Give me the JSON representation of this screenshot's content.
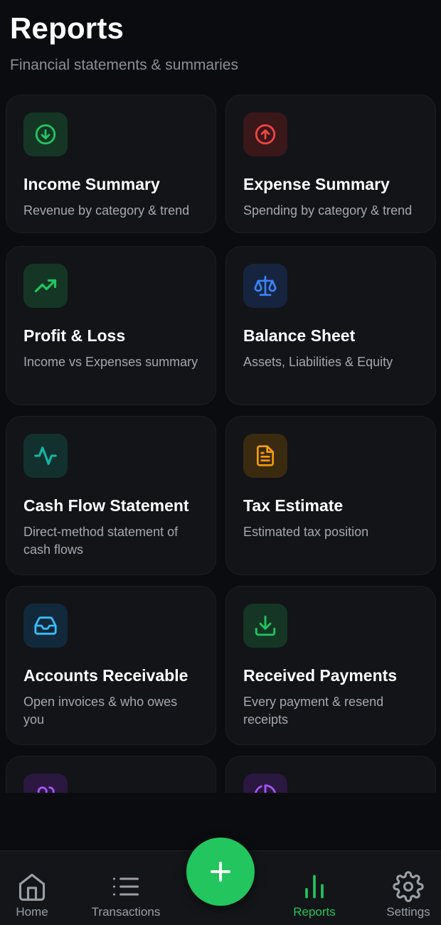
{
  "header": {
    "title": "Reports",
    "subtitle": "Financial statements & summaries"
  },
  "cards": [
    {
      "title": "Income Summary",
      "description": "Revenue by category & trend",
      "icon": "arrow-down-circle-icon",
      "color": "#22c55e"
    },
    {
      "title": "Expense Summary",
      "description": "Spending by category & trend",
      "icon": "arrow-up-circle-icon",
      "color": "#ef4444"
    },
    {
      "title": "Profit & Loss",
      "description": "Income vs Expenses summary",
      "icon": "trending-up-icon",
      "color": "#22c55e"
    },
    {
      "title": "Balance Sheet",
      "description": "Assets, Liabilities & Equity",
      "icon": "scale-icon",
      "color": "#3b82f6"
    },
    {
      "title": "Cash Flow Statement",
      "description": "Direct-method statement of cash flows",
      "icon": "activity-icon",
      "color": "#14b8a6"
    },
    {
      "title": "Tax Estimate",
      "description": "Estimated tax position",
      "icon": "document-icon",
      "color": "#f59e0b"
    },
    {
      "title": "Accounts Receivable",
      "description": "Open invoices & who owes you",
      "icon": "inbox-icon",
      "color": "#38bdf8"
    },
    {
      "title": "Received Payments",
      "description": "Every payment & resend receipts",
      "icon": "download-icon",
      "color": "#22c55e"
    },
    {
      "title": "",
      "description": "",
      "icon": "users-icon",
      "color": "#a855f7"
    },
    {
      "title": "",
      "description": "",
      "icon": "pie-chart-icon",
      "color": "#a855f7"
    }
  ],
  "nav": {
    "home": "Home",
    "transactions": "Transactions",
    "reports": "Reports",
    "settings": "Settings",
    "active": "reports"
  },
  "fab": {
    "icon": "plus-icon",
    "color": "#22c55e"
  }
}
